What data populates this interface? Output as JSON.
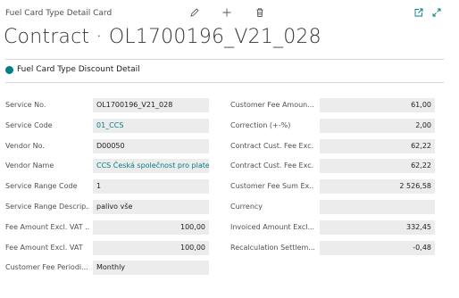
{
  "header": {
    "breadcrumb": "Fuel Card Type Detail Card",
    "title": "Contract · OL1700196_V21_028"
  },
  "toolbar": {
    "icons": [
      "pencil-icon",
      "plus-icon",
      "trash-icon",
      "open-in-new-window-icon",
      "expand-icon"
    ]
  },
  "actions": {
    "detail_label": "Fuel Card Type Discount Detail",
    "accent_color": "#007d85"
  },
  "fields_left": [
    {
      "label": "Service No.",
      "value": "OL1700196_V21_028"
    },
    {
      "label": "Service Code",
      "value": "01_CCS"
    },
    {
      "label": "Vendor No.",
      "value": "D00050"
    },
    {
      "label": "Vendor Name",
      "value": "CCS Česká společnost pro plate..."
    },
    {
      "label": "Service Range Code",
      "value": "1"
    },
    {
      "label": "Service Range Descrip...",
      "value": "palivo vše"
    },
    {
      "label": "Fee Amount Excl. VAT ...",
      "value": "100,00"
    },
    {
      "label": "Fee Amount Excl. VAT",
      "value": "100,00"
    },
    {
      "label": "Customer Fee Periodi...",
      "value": "Monthly"
    }
  ],
  "fields_right": [
    {
      "label": "Customer Fee Amoun...",
      "value": "61,00"
    },
    {
      "label": "Correction (+-%)",
      "value": "2,00"
    },
    {
      "label": "Contract Cust. Fee Exc...",
      "value": "62,22"
    },
    {
      "label": "Contract Cust. Fee Exc...",
      "value": "62,22"
    },
    {
      "label": "Customer Fee Sum Ex...",
      "value": "2 526,58"
    },
    {
      "label": "Currency",
      "value": ""
    },
    {
      "label": "Invoiced Amount Excl....",
      "value": "332,45"
    },
    {
      "label": "Recalculation Settlem...",
      "value": "-0,48"
    }
  ]
}
